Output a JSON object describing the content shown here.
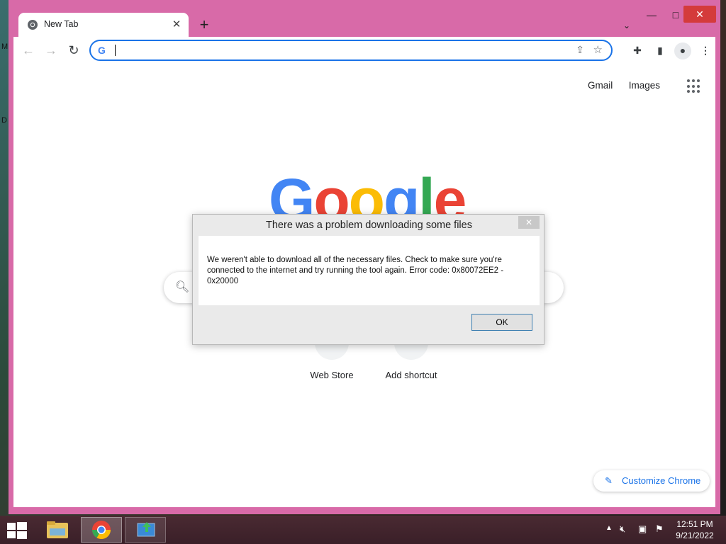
{
  "desktop": {
    "glyph_top": "M",
    "glyph_mid": "D"
  },
  "browser": {
    "tab_title": "New Tab",
    "new_tab_symbol": "+",
    "window": {
      "minimize": "—",
      "maximize": "□",
      "close": "✕"
    },
    "toolbar": {
      "back_symbol": "←",
      "forward_symbol": "→",
      "reload_symbol": "↻",
      "omnibox_value": "",
      "omnibox_placeholder": ""
    }
  },
  "ntp": {
    "top_links": [
      "Gmail",
      "Images"
    ],
    "logo": [
      "G",
      "o",
      "o",
      "g",
      "l",
      "e"
    ],
    "shortcuts": [
      {
        "label": "Web Store"
      },
      {
        "label": "Add shortcut"
      }
    ],
    "customize_label": "Customize Chrome"
  },
  "dialog": {
    "title": "There was a problem downloading some files",
    "message": "We weren't able to download all of the necessary files. Check to make sure you're connected to the internet and try running the tool again. Error code: 0x80072EE2 - 0x20000",
    "ok_label": "OK"
  },
  "taskbar": {
    "time": "12:51 PM",
    "date": "9/21/2022"
  },
  "colors": {
    "window_frame": "#d86aa8",
    "accent": "#1a73e8",
    "google_blue": "#4285f4",
    "google_red": "#ea4335",
    "google_yellow": "#fbbc05",
    "google_green": "#34a853"
  }
}
